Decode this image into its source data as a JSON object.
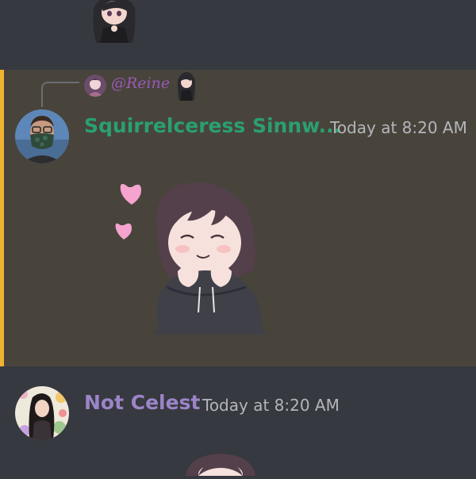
{
  "messages": [
    {
      "id": "prev",
      "sticker": "anime-girl-sticker"
    },
    {
      "id": "highlighted",
      "reply": {
        "mention": "@Reine",
        "sticker": "anime-girl-mini-sticker"
      },
      "author": "Squirrelceress Sinnw...",
      "timestamp": "Today at 8:20 AM",
      "sticker": "smiling-girl-hearts-sticker",
      "highlight_color": "#f0b232",
      "name_color": "#2aa06f"
    },
    {
      "id": "next",
      "author": "Not Celest",
      "timestamp": "Today at 8:20 AM",
      "name_color": "#9b84c8",
      "sticker": "girl-sticker-partial"
    }
  ]
}
